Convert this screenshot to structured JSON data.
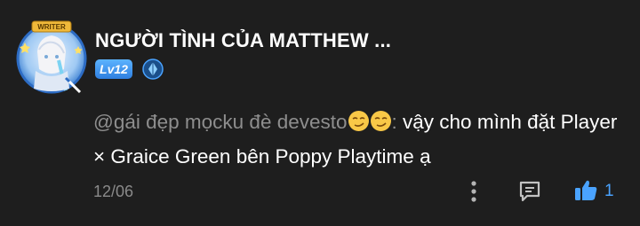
{
  "user": {
    "name": "NGƯỜI TÌNH CỦA MATTHEW ...",
    "level": "Lv12",
    "avatar_frame_label": "WRITER"
  },
  "comment": {
    "mention": "@gái đẹp mọcku đè devesto",
    "emojis": [
      "smirk-emoji",
      "smirk-emoji"
    ],
    "separator": ":",
    "body": " vậy cho mình đặt Player × Graice Green bên Poppy Playtime ạ"
  },
  "footer": {
    "date": "12/06",
    "like_count": "1"
  },
  "colors": {
    "background": "#1e1e1e",
    "mention": "#8e8e8e",
    "accent_blue": "#4aa3ff",
    "level_badge": "#3f94f0"
  }
}
